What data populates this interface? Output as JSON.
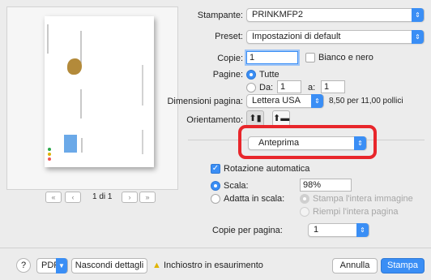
{
  "preview": {
    "page_indicator": "1 di 1",
    "nav_first": "«",
    "nav_prev": "‹",
    "nav_next": "›",
    "nav_last": "»"
  },
  "printer": {
    "label": "Stampante:",
    "value": "PRINKMFP2"
  },
  "preset": {
    "label": "Preset:",
    "value": "Impostazioni di default"
  },
  "copies": {
    "label": "Copie:",
    "value": "1",
    "bw_label": "Bianco e nero"
  },
  "pages": {
    "label": "Pagine:",
    "all_label": "Tutte",
    "from_label": "Da:",
    "from_value": "1",
    "to_label": "a:",
    "to_value": "1"
  },
  "paper_size": {
    "label": "Dimensioni pagina:",
    "value": "Lettera USA",
    "dims": "8,50 per 11,00 pollici"
  },
  "orientation": {
    "label": "Orientamento:"
  },
  "section_menu": {
    "value": "Anteprima"
  },
  "auto_rotate": {
    "label": "Rotazione automatica"
  },
  "scale": {
    "label": "Scala:",
    "value": "98%"
  },
  "fit": {
    "label": "Adatta in scala:",
    "option_print_full": "Stampa l'intera immagine",
    "option_fill": "Riempi l'intera pagina"
  },
  "copies_per_page": {
    "label": "Copie per pagina:",
    "value": "1"
  },
  "footer": {
    "help": "?",
    "pdf_label": "PDF",
    "hide_details": "Nascondi dettagli",
    "warning_text": "Inchiostro in esaurimento",
    "cancel": "Annulla",
    "print": "Stampa"
  },
  "colors": {
    "accent": "#3a8ef5",
    "highlight": "#e8262b",
    "warning": "#e0b400"
  }
}
